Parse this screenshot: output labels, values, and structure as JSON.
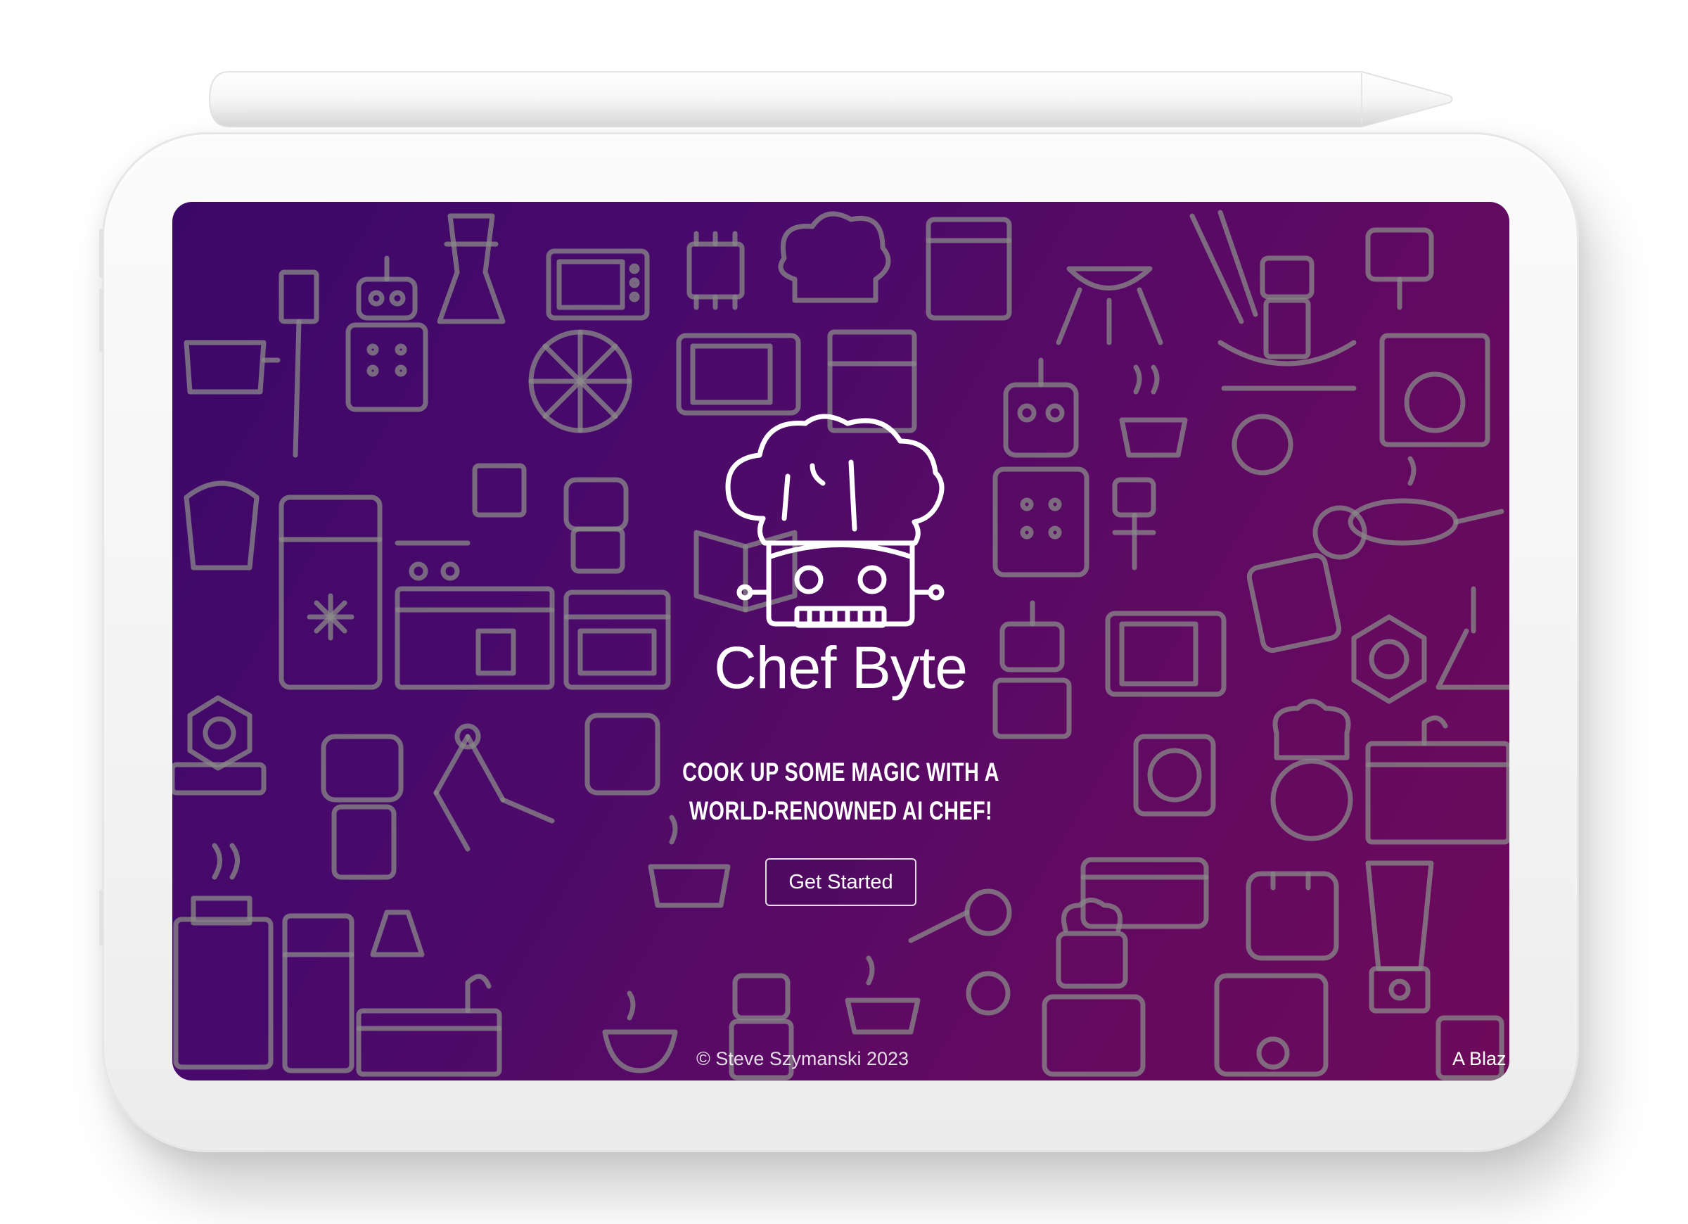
{
  "app": {
    "brand_name": "Chef Byte",
    "tagline_line1": "COOK UP SOME MAGIC WITH A",
    "tagline_line2": "WORLD-RENOWNED AI CHEF!",
    "cta_label": "Get Started",
    "copyright": "© Steve Szymanski 2023",
    "footer_right": "A Blaz"
  },
  "icons": {
    "logo": "robot-chef-hat-logo",
    "background_pattern": [
      "robot-icon",
      "chef-hat-icon",
      "microwave-icon",
      "refrigerator-icon",
      "pot-icon",
      "pizza-icon",
      "ai-chip-icon",
      "robot-arm-icon",
      "blender-icon",
      "toaster-icon",
      "grill-icon",
      "stove-icon",
      "spatula-icon",
      "coffee-cup-icon",
      "kitchen-icon"
    ]
  },
  "colors": {
    "gradient_start": "#3c0868",
    "gradient_end": "#6e0a5a",
    "pattern_stroke": "#8a8a8a",
    "text": "#ffffff",
    "device_frame": "#f5f5f5"
  }
}
